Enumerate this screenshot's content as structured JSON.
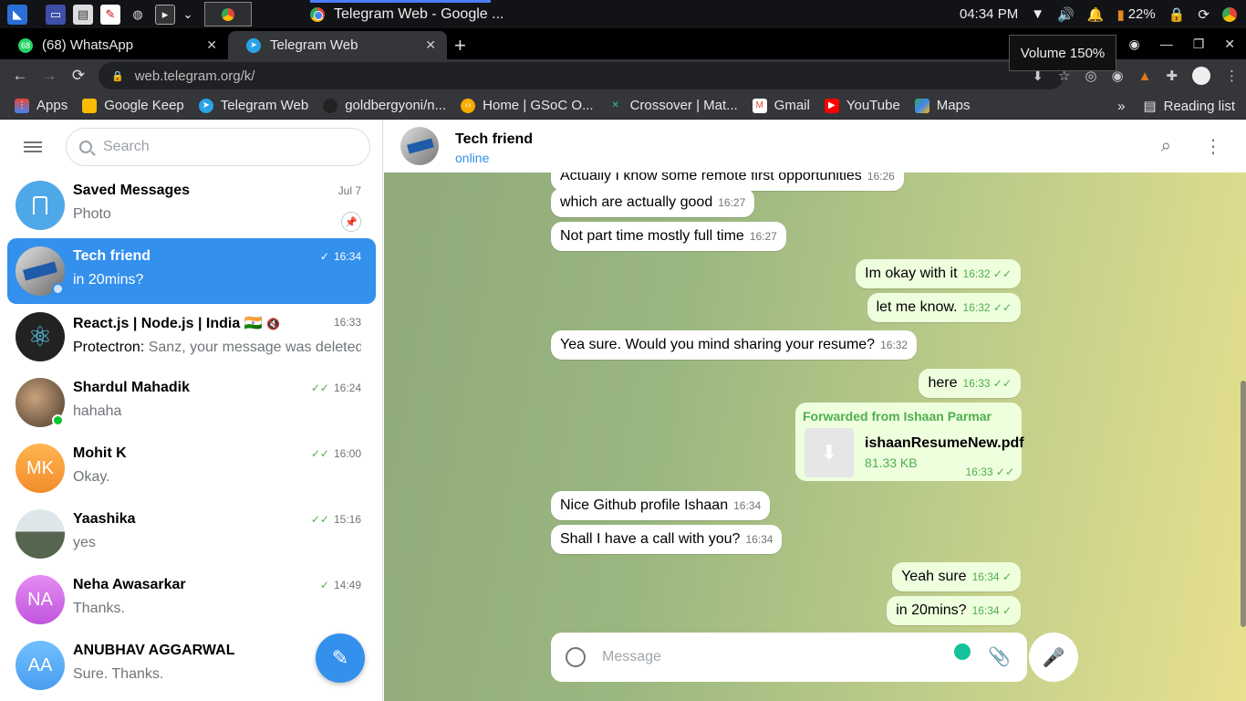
{
  "taskbar": {
    "window_title": "Telegram Web - Google ...",
    "clock": "04:34 PM",
    "battery": "22%"
  },
  "tabs": [
    {
      "label": "(68) WhatsApp",
      "badge": "68"
    },
    {
      "label": "Telegram Web"
    }
  ],
  "volume_tooltip": "Volume 150%",
  "address": "web.telegram.org/k/",
  "bookmarks": [
    {
      "label": "Apps"
    },
    {
      "label": "Google Keep"
    },
    {
      "label": "Telegram Web"
    },
    {
      "label": "goldbergyoni/n..."
    },
    {
      "label": "Home | GSoC O..."
    },
    {
      "label": "Crossover | Mat..."
    },
    {
      "label": "Gmail"
    },
    {
      "label": "YouTube"
    },
    {
      "label": "Maps"
    }
  ],
  "reading_list": "Reading list",
  "search_placeholder": "Search",
  "chats": [
    {
      "name": "Saved Messages",
      "preview": "Photo",
      "time": "Jul 7",
      "avatar_color": "#4fa8e8"
    },
    {
      "name": "Tech friend",
      "preview": "in 20mins?",
      "time": "16:34",
      "avatar_color": "#8a8a8a"
    },
    {
      "name": "React.js | Node.js | India 🇮🇳",
      "sender": "Protectron:",
      "preview": "Sanz, your message was deleted",
      "time": "16:33",
      "avatar_color": "#222222"
    },
    {
      "name": "Shardul Mahadik",
      "preview": "hahaha",
      "time": "16:24",
      "avatar_color": "#9a8060"
    },
    {
      "name": "Mohit K",
      "initials": "MK",
      "preview": "Okay.",
      "time": "16:00",
      "avatar_color": "#f7a542"
    },
    {
      "name": "Yaashika",
      "preview": "yes",
      "time": "15:16",
      "avatar_color": "#6b7d6a"
    },
    {
      "name": "Neha Awasarkar",
      "initials": "NA",
      "preview": "Thanks.",
      "time": "14:49",
      "avatar_color": "#c66ee0"
    },
    {
      "name": "ANUBHAV AGGARWAL",
      "initials": "AA",
      "preview": "Sure. Thanks.",
      "avatar_color": "#5caffa"
    }
  ],
  "conversation": {
    "name": "Tech friend",
    "status": "online",
    "messages": [
      {
        "text": "Actually I know some remote first opportunities",
        "time": "16:26",
        "out": false
      },
      {
        "text": "which are actually good",
        "time": "16:27",
        "out": false
      },
      {
        "text": "Not part time mostly full time",
        "time": "16:27",
        "out": false
      },
      {
        "text": "Im okay with it",
        "time": "16:32",
        "out": true
      },
      {
        "text": "let me know.",
        "time": "16:32",
        "out": true
      },
      {
        "text": "Yea sure. Would you mind sharing your resume?",
        "time": "16:32",
        "out": false
      },
      {
        "text": "here",
        "time": "16:33",
        "out": true
      },
      {
        "text": "Nice Github profile Ishaan",
        "time": "16:34",
        "out": false
      },
      {
        "text": "Shall I have a call with you?",
        "time": "16:34",
        "out": false
      },
      {
        "text": "Yeah sure",
        "time": "16:34",
        "out": true
      },
      {
        "text": "in 20mins?",
        "time": "16:34",
        "out": true
      }
    ],
    "forwarded": {
      "from": "Forwarded from Ishaan Parmar",
      "filename": "ishaanResumeNew.pdf",
      "size": "81.33 KB",
      "time": "16:33"
    }
  },
  "composer_placeholder": "Message",
  "colors": {
    "accent": "#3390ec",
    "outgoing": "#eeffde",
    "read_tick": "#4fae4e"
  }
}
